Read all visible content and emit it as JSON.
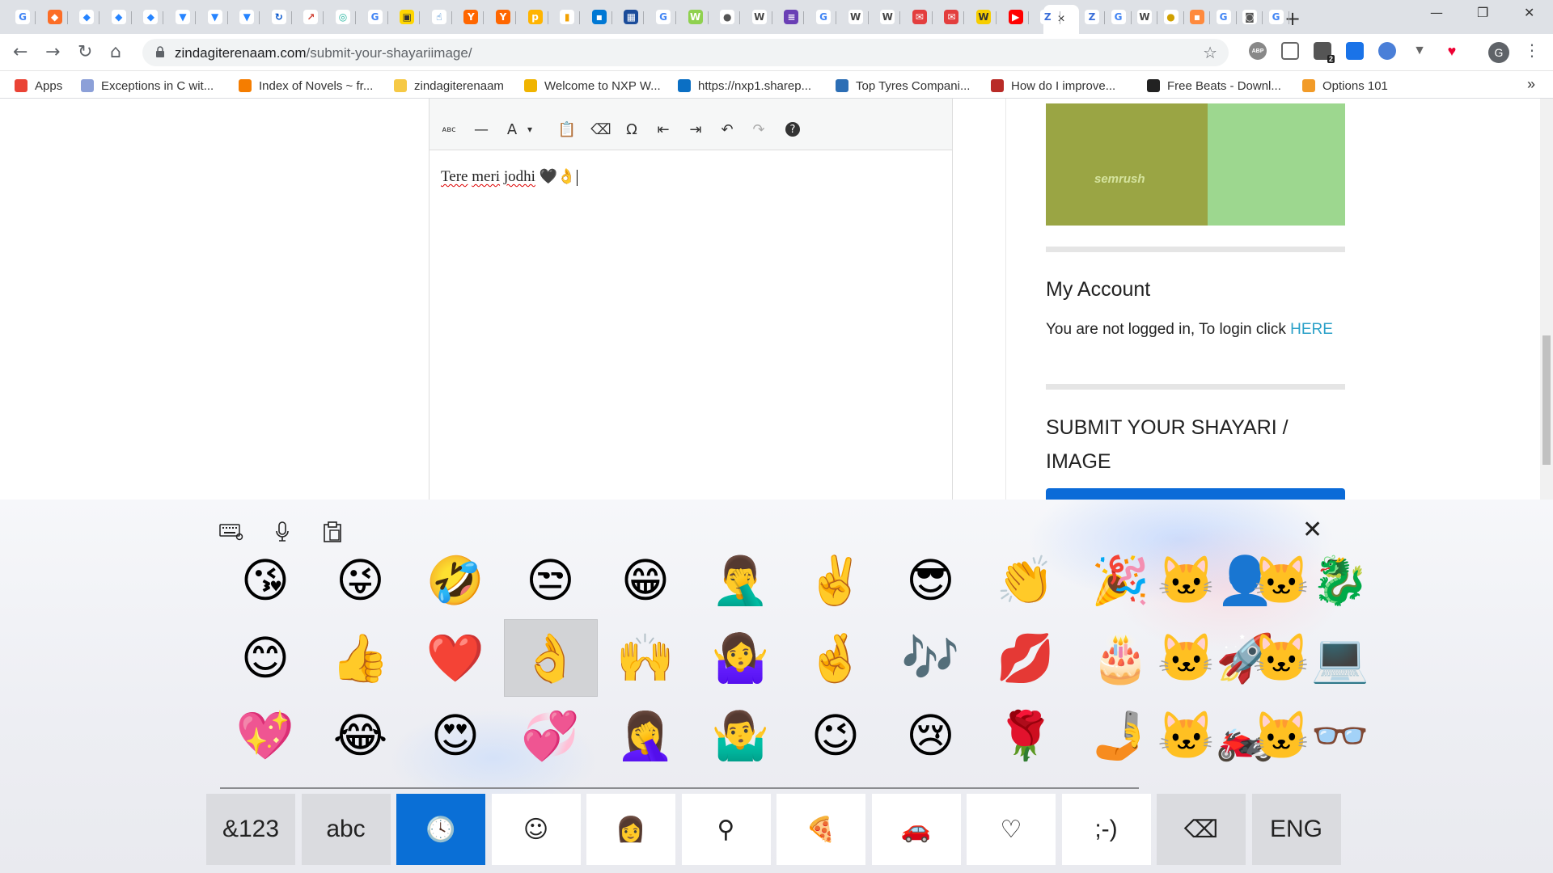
{
  "browser": {
    "active_tab_close": "×",
    "new_tab": "+",
    "window_controls": {
      "minimize": "—",
      "restore": "❐",
      "close": "✕"
    },
    "nav": {
      "back": "←",
      "forward": "→",
      "reload": "↻",
      "home": "⌂"
    },
    "url_domain": "zindagiterenaam.com",
    "url_path": "/submit-your-shayariimage/",
    "bookmark_star": "☆",
    "extension_badge": "2",
    "extension_abp": "ABP",
    "profile_initial": "G",
    "menu": "⋮",
    "tab_favicons": [
      {
        "g": "G",
        "c": "#ffffff",
        "t": "#4285f4"
      },
      {
        "g": "◆",
        "c": "#fc6d26",
        "t": "#fff"
      },
      {
        "g": "◆",
        "c": "#ffffff",
        "t": "#2684ff"
      },
      {
        "g": "◆",
        "c": "#ffffff",
        "t": "#2684ff"
      },
      {
        "g": "◆",
        "c": "#ffffff",
        "t": "#2684ff"
      },
      {
        "g": "▼",
        "c": "#ffffff",
        "t": "#2684ff"
      },
      {
        "g": "▼",
        "c": "#ffffff",
        "t": "#2684ff"
      },
      {
        "g": "▼",
        "c": "#ffffff",
        "t": "#2684ff"
      },
      {
        "g": "↻",
        "c": "#ffffff",
        "t": "#0052cc"
      },
      {
        "g": "↗",
        "c": "#ffffff",
        "t": "#d04437"
      },
      {
        "g": "◎",
        "c": "#ffffff",
        "t": "#26b5a0"
      },
      {
        "g": "G",
        "c": "#ffffff",
        "t": "#4285f4"
      },
      {
        "g": "▣",
        "c": "#ffd600",
        "t": "#333"
      },
      {
        "g": "☝",
        "c": "#ffffff",
        "t": "#0a66c2"
      },
      {
        "g": "Y",
        "c": "#ff6600",
        "t": "#fff"
      },
      {
        "g": "Y",
        "c": "#ff6600",
        "t": "#fff"
      },
      {
        "g": "p",
        "c": "#ffb400",
        "t": "#fff"
      },
      {
        "g": "▮",
        "c": "#ffffff",
        "t": "#f2a100"
      },
      {
        "g": "▪",
        "c": "#0078d4",
        "t": "#fff"
      },
      {
        "g": "▦",
        "c": "#1b4c9a",
        "t": "#fff"
      },
      {
        "g": "G",
        "c": "#ffffff",
        "t": "#4285f4"
      },
      {
        "g": "W",
        "c": "#8fd14f",
        "t": "#fff"
      },
      {
        "g": "●",
        "c": "#ffffff",
        "t": "#555"
      },
      {
        "g": "W",
        "c": "#ffffff",
        "t": "#464646"
      },
      {
        "g": "≡",
        "c": "#6a3fb5",
        "t": "#fff"
      },
      {
        "g": "G",
        "c": "#ffffff",
        "t": "#4285f4"
      },
      {
        "g": "W",
        "c": "#ffffff",
        "t": "#464646"
      },
      {
        "g": "W",
        "c": "#ffffff",
        "t": "#464646"
      },
      {
        "g": "✉",
        "c": "#e33e3e",
        "t": "#fff"
      },
      {
        "g": "✉",
        "c": "#e33e3e",
        "t": "#fff"
      },
      {
        "g": "W",
        "c": "#f7ce00",
        "t": "#333"
      },
      {
        "g": "▶",
        "c": "#ff0000",
        "t": "#fff"
      },
      {
        "g": "Z",
        "c": "#ffffff",
        "t": "#3a6ed8"
      }
    ],
    "tab_favicons_after": [
      {
        "g": "Z",
        "c": "#ffffff",
        "t": "#3a6ed8"
      },
      {
        "g": "G",
        "c": "#ffffff",
        "t": "#4285f4"
      },
      {
        "g": "W",
        "c": "#ffffff",
        "t": "#464646"
      },
      {
        "g": "●",
        "c": "#ffffff",
        "t": "#d0a000"
      },
      {
        "g": "▪",
        "c": "#ff8a3d",
        "t": "#fff"
      },
      {
        "g": "G",
        "c": "#ffffff",
        "t": "#4285f4"
      },
      {
        "g": "◙",
        "c": "#ffffff",
        "t": "#555"
      },
      {
        "g": "G",
        "c": "#ffffff",
        "t": "#4285f4"
      }
    ]
  },
  "bookmarks": [
    {
      "label": "Apps",
      "color": "#ea4335"
    },
    {
      "label": "Exceptions in C wit...",
      "color": "#8ca0d8"
    },
    {
      "label": "Index of Novels ~ fr...",
      "color": "#f57d00"
    },
    {
      "label": "zindagiterenaam",
      "color": "#f6c945"
    },
    {
      "label": "Welcome to NXP W...",
      "color": "#f0b400"
    },
    {
      "label": "https://nxp1.sharep...",
      "color": "#0b6fc4"
    },
    {
      "label": "Top Tyres Compani...",
      "color": "#2c6eb5"
    },
    {
      "label": "How do I improve...",
      "color": "#b92b27"
    },
    {
      "label": "Free Beats - Downl...",
      "color": "#222222"
    },
    {
      "label": "Options 101",
      "color": "#f29b28"
    }
  ],
  "bookmarks_more": "»",
  "editor": {
    "toolbar": [
      "ᴀʙᴄ",
      "—",
      "A",
      "▾",
      "📋",
      "⌫",
      "Ω",
      "⇤",
      "⇥",
      "↶",
      "↷",
      "?"
    ],
    "content_word1": "Tere",
    "content_word2": "meri",
    "content_word3": "jodhi",
    "content_emoji": "🖤👌"
  },
  "sidebar": {
    "ad_logo": "semrush",
    "account_title": "My Account",
    "account_text": "You are not logged in, To login click ",
    "account_link": "HERE",
    "submit_title_line1": "SUBMIT YOUR SHAYARI /",
    "submit_title_line2": "IMAGE"
  },
  "keyboard": {
    "top_icons": [
      "⌨",
      "🎤",
      "📋"
    ],
    "close": "✕",
    "emojis": [
      [
        "😘",
        "😜",
        "🤣",
        "😒",
        "😁",
        "🤦‍♂️",
        "✌️",
        "😎",
        "👏",
        "🎉",
        "🐱‍👤",
        "🐱‍🐉"
      ],
      [
        "😊",
        "👍",
        "❤️",
        "👌",
        "🙌",
        "🤷‍♀️",
        "🤞",
        "🎶",
        "💋",
        "🎂",
        "🐱‍🚀",
        "🐱‍💻"
      ],
      [
        "💖",
        "😂",
        "😍",
        "💞",
        "🤦‍♀️",
        "🤷‍♂️",
        "😉",
        "😢",
        "🌹",
        "🤳",
        "🐱‍🏍",
        "🐱‍👓"
      ]
    ],
    "selected_emoji": "👌",
    "categories": [
      {
        "label": "&123",
        "type": "text"
      },
      {
        "label": "abc",
        "type": "text"
      },
      {
        "label": "🕓",
        "type": "icon"
      },
      {
        "label": "☺",
        "type": "icon"
      },
      {
        "label": "👩",
        "type": "icon"
      },
      {
        "label": "⚲",
        "type": "icon"
      },
      {
        "label": "🍕",
        "type": "icon"
      },
      {
        "label": "🚗",
        "type": "icon"
      },
      {
        "label": "♡",
        "type": "icon"
      },
      {
        "label": ";-)",
        "type": "text"
      },
      {
        "label": "⌫",
        "type": "icon"
      },
      {
        "label": "ENG",
        "type": "text"
      }
    ]
  }
}
